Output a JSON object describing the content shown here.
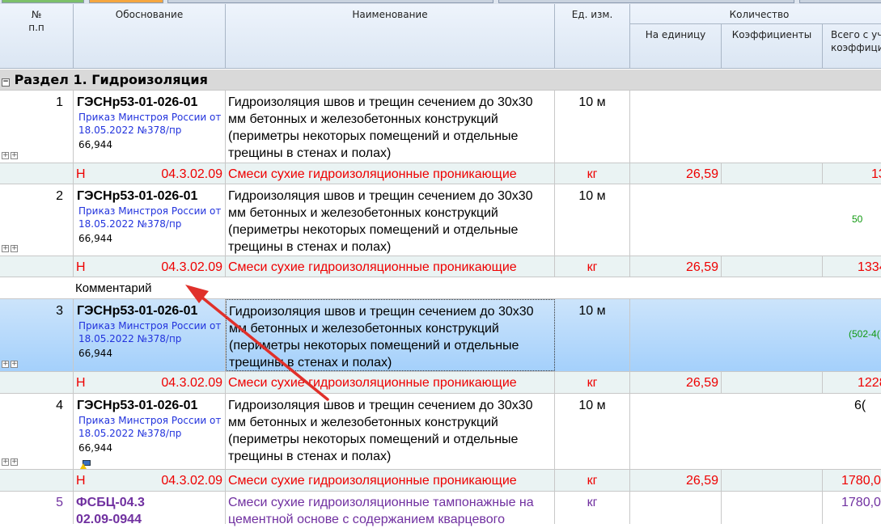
{
  "header": {
    "num": "№",
    "num2": "п.п",
    "basis": "Обоснование",
    "name": "Наименование",
    "unit": "Ед. изм.",
    "qty": "Количество",
    "per_unit": "На единицу",
    "coef": "Коэффициенты",
    "total": "Всего с уч",
    "total2": "коэффицие"
  },
  "section": {
    "title": "Раздел 1. Гидроизоляция"
  },
  "rows": [
    {
      "num": "1",
      "code": "ГЭСНр53-01-026-01",
      "order": "Приказ Минстроя России от",
      "order2": "18.05.2022 №378/пр",
      "qty": "66,944",
      "name": "Гидроизоляция швов и трещин сечением до 30х30 мм бетонных и железобетонных конструкций (периметры некоторых помещений и отдельные трещины в стенах и полах)",
      "unit": "10 м",
      "extra": ""
    },
    {
      "num": "2",
      "code": "ГЭСНр53-01-026-01",
      "order": "Приказ Минстроя России от",
      "order2": "18.05.2022 №378/пр",
      "qty": "66,944",
      "name": "Гидроизоляция швов и трещин сечением до 30х30 мм бетонных и железобетонных конструкций (периметры некоторых помещений и отдельные трещины в стенах и полах)",
      "unit": "10 м",
      "extra": "50"
    },
    {
      "num": "3",
      "code": "ГЭСНр53-01-026-01",
      "order": "Приказ Минстроя России от",
      "order2": "18.05.2022 №378/пр",
      "qty": "66,944",
      "name": "Гидроизоляция швов и трещин сечением до 30х30 мм бетонных и железобетонных конструкций (периметры некоторых помещений и отдельные трещины в стенах и полах)",
      "unit": "10 м",
      "extra": "(502-4("
    },
    {
      "num": "4",
      "code": "ГЭСНр53-01-026-01",
      "order": "Приказ Минстроя России от",
      "order2": "18.05.2022 №378/пр",
      "qty": "66,944",
      "name": "Гидроизоляция швов и трещин сечением до 30х30 мм бетонных и железобетонных конструкций (периметры некоторых помещений и отдельные трещины в стенах и полах)",
      "unit": "10 м",
      "extra": "6("
    }
  ],
  "resources": [
    {
      "type": "Н",
      "code": "04.3.02.09",
      "name": "Смеси сухие гидроизоляционные проникающие",
      "unit": "кг",
      "per_unit": "26,59",
      "total": "13"
    },
    {
      "type": "Н",
      "code": "04.3.02.09",
      "name": "Смеси сухие гидроизоляционные проникающие",
      "unit": "кг",
      "per_unit": "26,59",
      "total": "1334"
    },
    {
      "type": "Н",
      "code": "04.3.02.09",
      "name": "Смеси сухие гидроизоляционные проникающие",
      "unit": "кг",
      "per_unit": "26,59",
      "total": "1228"
    },
    {
      "type": "Н",
      "code": "04.3.02.09",
      "name": "Смеси сухие гидроизоляционные проникающие",
      "unit": "кг",
      "per_unit": "26,59",
      "total": "1780,0"
    }
  ],
  "comment": "Комментарий",
  "row5": {
    "num": "5",
    "code": "ФСБЦ-04.3",
    "code2": "02.09-0944",
    "name": "Смеси сухие гидроизоляционные тампонажные на",
    "name2": "цементной основе с содержанием кварцевого",
    "unit": "кг",
    "total": "1780,0"
  },
  "colors": {
    "red": "#ee0000",
    "purple": "#7030a0",
    "green": "#119911",
    "selection": "#b8dafb",
    "arrow": "#e0302a"
  }
}
